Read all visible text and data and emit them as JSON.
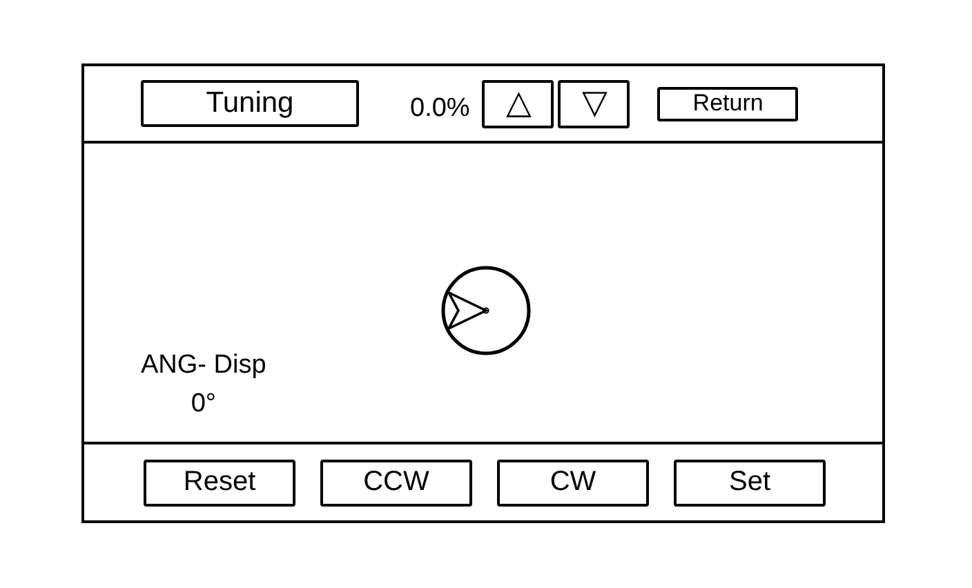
{
  "header": {
    "mode_button": "Tuning",
    "percent": "0.0%",
    "up_button": "△",
    "down_button": "▽",
    "return_button": "Return"
  },
  "display": {
    "label": "ANG- Disp",
    "value": "0°"
  },
  "buttons": [
    "Reset",
    "CCW",
    "CW",
    "Set"
  ]
}
